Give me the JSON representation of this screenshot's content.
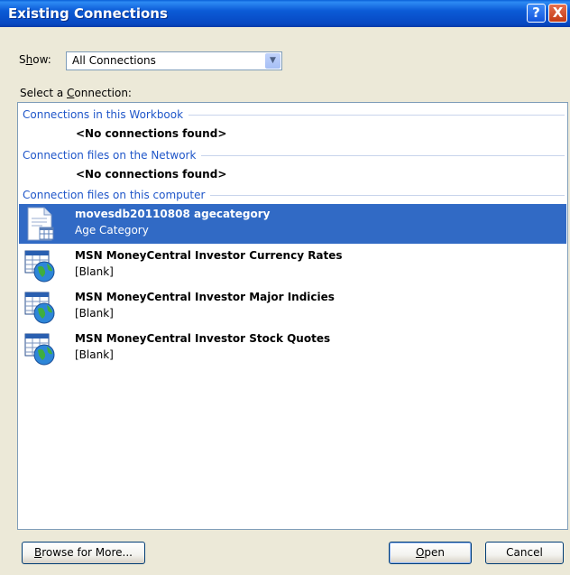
{
  "window": {
    "title": "Existing Connections",
    "help_label": "?",
    "close_label": "X"
  },
  "show": {
    "label_prefix": "S",
    "label_underlined": "h",
    "label_suffix": "ow:",
    "selected": "All Connections",
    "arrow": "▼"
  },
  "list": {
    "caption_prefix": "Select a ",
    "caption_underlined": "C",
    "caption_suffix": "onnection:",
    "sections": [
      {
        "header": "Connections in this Workbook",
        "empty_text": "<No connections found>"
      },
      {
        "header": "Connection files on the Network",
        "empty_text": "<No connections found>"
      },
      {
        "header": "Connection files on this computer"
      }
    ],
    "items": [
      {
        "name": "movesdb20110808 agecategory",
        "description": "Age Category",
        "icon": "odc-file-icon",
        "selected": true
      },
      {
        "name": "MSN MoneyCentral Investor Currency Rates",
        "description": "[Blank]",
        "icon": "web-query-icon",
        "selected": false
      },
      {
        "name": "MSN MoneyCentral Investor Major Indicies",
        "description": "[Blank]",
        "icon": "web-query-icon",
        "selected": false
      },
      {
        "name": "MSN MoneyCentral Investor Stock Quotes",
        "description": "[Blank]",
        "icon": "web-query-icon",
        "selected": false
      }
    ]
  },
  "buttons": {
    "browse_underlined": "B",
    "browse_rest": "rowse for More...",
    "open_underlined": "O",
    "open_rest": "pen",
    "cancel": "Cancel"
  },
  "colors": {
    "title_bar": "#0b5bd6",
    "selection": "#316ac5",
    "section_header": "#1f56c9",
    "dialog_background": "#ece9d8"
  }
}
